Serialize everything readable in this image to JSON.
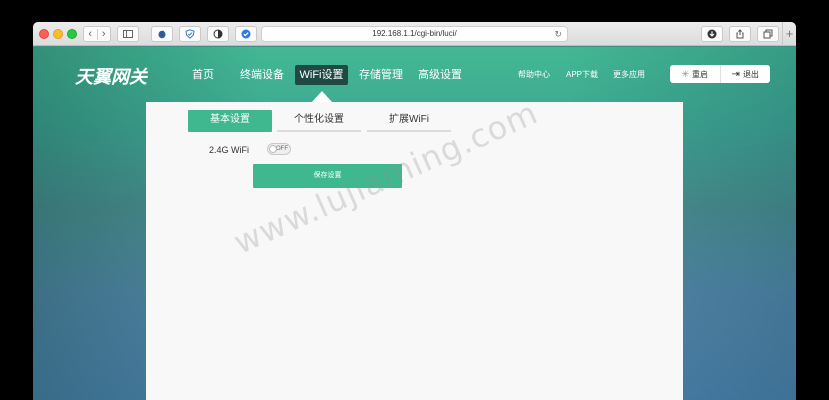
{
  "browser": {
    "url": "192.168.1.1/cgi-bin/luci/",
    "nav_back": "‹",
    "nav_forward": "›",
    "reload_glyph": "↻",
    "new_tab": "+"
  },
  "header": {
    "logo": "天翼网关",
    "nav": [
      {
        "label": "首页"
      },
      {
        "label": "终端设备"
      },
      {
        "label": "WiFi设置"
      },
      {
        "label": "存储管理"
      },
      {
        "label": "高级设置"
      }
    ],
    "links": [
      {
        "label": "帮助中心"
      },
      {
        "label": "APP下载"
      },
      {
        "label": "更多应用"
      }
    ],
    "reboot_label": "重启",
    "logout_label": "退出"
  },
  "panel": {
    "tabs": [
      {
        "label": "基本设置"
      },
      {
        "label": "个性化设置"
      },
      {
        "label": "扩展WiFi"
      }
    ],
    "wifi_label": "2.4G WiFi",
    "toggle_state": "OFF",
    "save_label": "保存设置"
  },
  "watermark": "www.lujiaming.com",
  "colors": {
    "accent": "#40b88f",
    "nav_active": "#1f4a43"
  }
}
